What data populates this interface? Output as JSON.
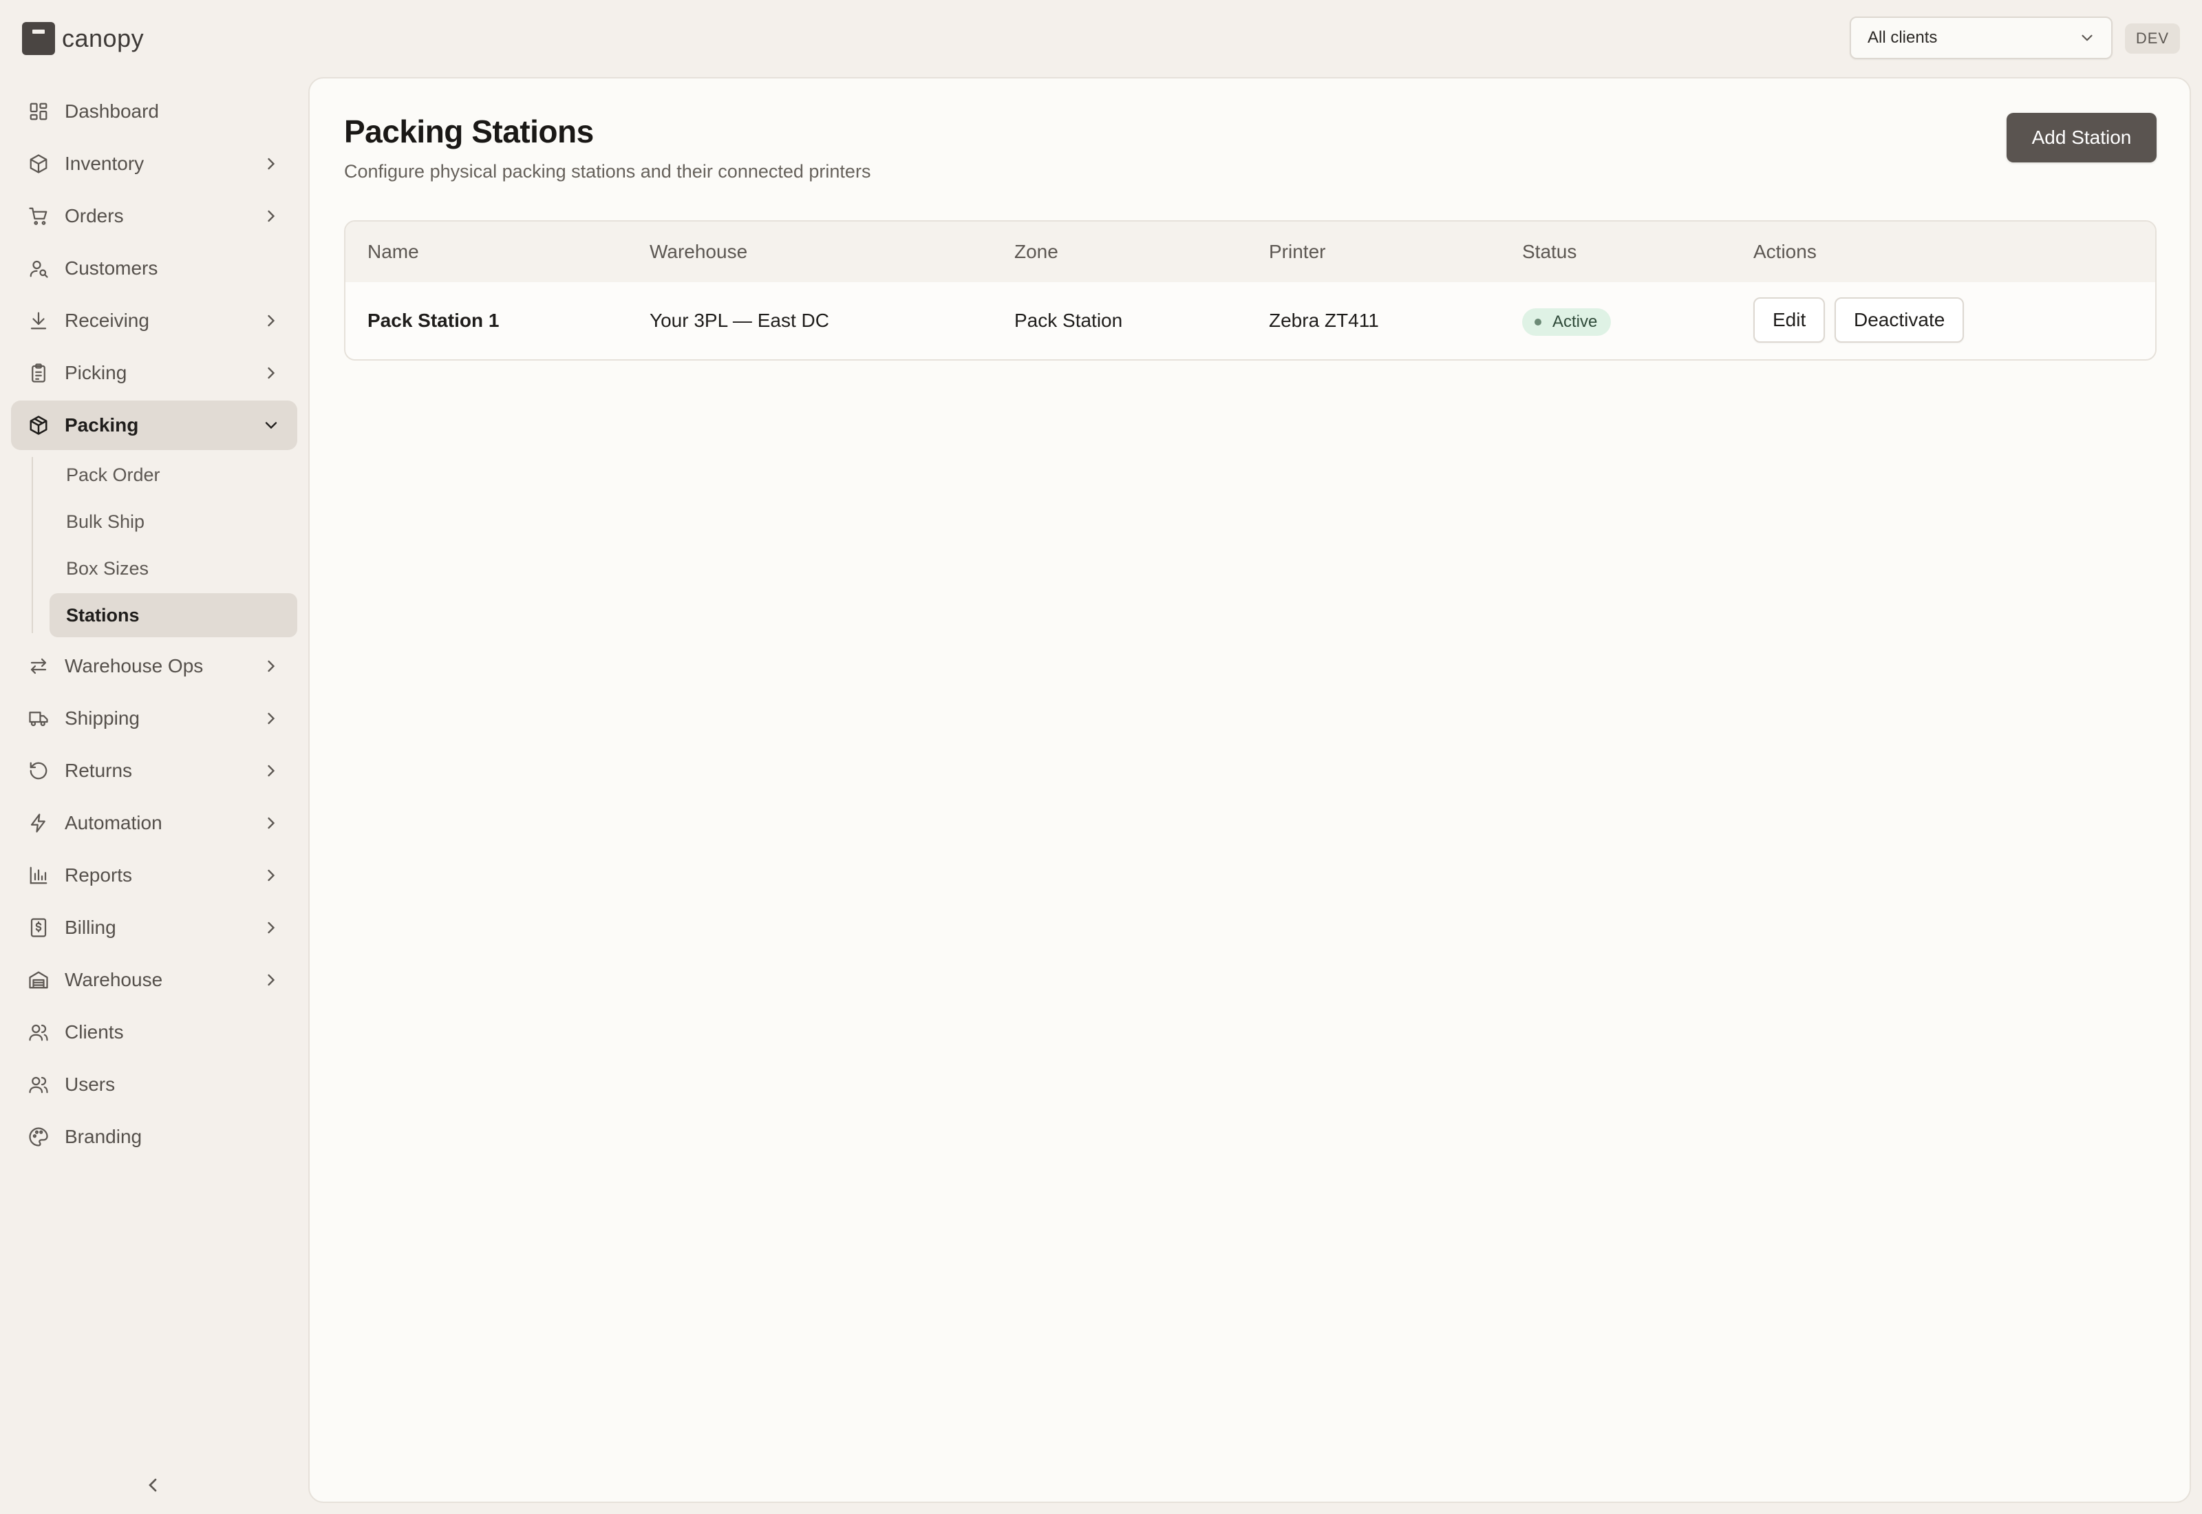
{
  "app": {
    "name": "canopy"
  },
  "header": {
    "client_select": "All clients",
    "env_badge": "DEV"
  },
  "sidebar": {
    "items": [
      {
        "label": "Dashboard",
        "icon": "dashboard-icon"
      },
      {
        "label": "Inventory",
        "icon": "box-icon"
      },
      {
        "label": "Orders",
        "icon": "cart-icon"
      },
      {
        "label": "Customers",
        "icon": "user-search-icon"
      },
      {
        "label": "Receiving",
        "icon": "download-icon"
      },
      {
        "label": "Picking",
        "icon": "clipboard-icon"
      },
      {
        "label": "Packing",
        "icon": "package-icon"
      },
      {
        "label": "Warehouse Ops",
        "icon": "arrows-icon"
      },
      {
        "label": "Shipping",
        "icon": "truck-icon"
      },
      {
        "label": "Returns",
        "icon": "rotate-icon"
      },
      {
        "label": "Automation",
        "icon": "bolt-icon"
      },
      {
        "label": "Reports",
        "icon": "bar-chart-icon"
      },
      {
        "label": "Billing",
        "icon": "receipt-icon"
      },
      {
        "label": "Warehouse",
        "icon": "warehouse-icon"
      },
      {
        "label": "Clients",
        "icon": "users-icon"
      },
      {
        "label": "Users",
        "icon": "users-icon"
      },
      {
        "label": "Branding",
        "icon": "palette-icon"
      }
    ],
    "packing_sub": [
      "Pack Order",
      "Bulk Ship",
      "Box Sizes",
      "Stations"
    ]
  },
  "main": {
    "title": "Packing Stations",
    "subtitle": "Configure physical packing stations and their connected printers",
    "add_button": "Add Station",
    "table": {
      "columns": [
        "Name",
        "Warehouse",
        "Zone",
        "Printer",
        "Status",
        "Actions"
      ],
      "rows": [
        {
          "name": "Pack Station 1",
          "warehouse": "Your 3PL — East DC",
          "zone": "Pack Station",
          "printer": "Zebra ZT411",
          "status": "Active",
          "edit": "Edit",
          "deactivate": "Deactivate"
        }
      ]
    }
  },
  "colors": {
    "accent_button": "#5a5450",
    "active_nav": "#e1dbd4",
    "status_active_bg": "#dff2e5"
  }
}
